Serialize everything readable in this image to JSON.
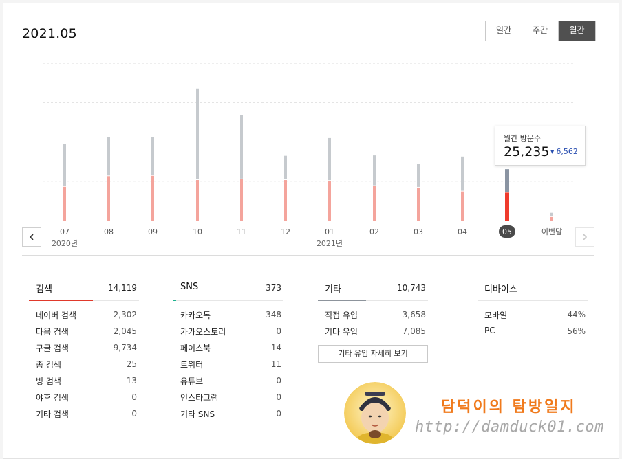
{
  "header": {
    "title": "2021.05"
  },
  "period_tabs": [
    {
      "label": "일간",
      "active": false
    },
    {
      "label": "주간",
      "active": false
    },
    {
      "label": "월간",
      "active": true
    }
  ],
  "colors": {
    "gray_bar": "#c6cace",
    "red_bar": "#f4a49c",
    "selected_red": "#ef3b2d",
    "selected_gray": "#8a94a2",
    "grid": "#dcdcdc"
  },
  "chart_data": {
    "type": "bar",
    "stacked": true,
    "categories": [
      "07",
      "08",
      "09",
      "10",
      "11",
      "12",
      "01",
      "02",
      "03",
      "04",
      "05",
      "이번달"
    ],
    "year_labels": [
      {
        "index": 0,
        "label": "2020년"
      },
      {
        "index": 6,
        "label": "2021년"
      }
    ],
    "series": [
      {
        "values": [
          8600,
          11300,
          11400,
          10300,
          10500,
          10300,
          10100,
          8800,
          8400,
          7400,
          7100,
          900
        ]
      },
      {
        "values": [
          10700,
          9700,
          9700,
          23100,
          16100,
          6000,
          10700,
          7600,
          5800,
          8700,
          5800,
          900
        ]
      }
    ],
    "ylim": [
      0,
      40000
    ],
    "grid": true,
    "selected_index": 10
  },
  "tooltip": {
    "label": "월간 방문수",
    "value": "25,235",
    "delta": "6,562",
    "delta_arrow": "▼"
  },
  "stats": [
    {
      "key": "search",
      "label": "검색",
      "total": "14,119",
      "accent": "#e0392b",
      "bar_fraction": 0.58,
      "rows": [
        {
          "label": "네이버 검색",
          "value": "2,302"
        },
        {
          "label": "다음 검색",
          "value": "2,045"
        },
        {
          "label": "구글 검색",
          "value": "9,734"
        },
        {
          "label": "좀 검색",
          "value": "25"
        },
        {
          "label": "빙 검색",
          "value": "13"
        },
        {
          "label": "야후 검색",
          "value": "0"
        },
        {
          "label": "기타 검색",
          "value": "0"
        }
      ]
    },
    {
      "key": "sns",
      "label": "SNS",
      "total": "373",
      "accent": "#1bb28e",
      "bar_fraction": 0.025,
      "rows": [
        {
          "label": "카카오톡",
          "value": "348"
        },
        {
          "label": "카카오스토리",
          "value": "0"
        },
        {
          "label": "페이스북",
          "value": "14"
        },
        {
          "label": "트위터",
          "value": "11"
        },
        {
          "label": "유튜브",
          "value": "0"
        },
        {
          "label": "인스타그램",
          "value": "0"
        },
        {
          "label": "기타 SNS",
          "value": "0"
        }
      ]
    },
    {
      "key": "etc",
      "label": "기타",
      "total": "10,743",
      "accent": "#8d949c",
      "bar_fraction": 0.44,
      "rows": [
        {
          "label": "직접 유입",
          "value": "3,658"
        },
        {
          "label": "기타 유입",
          "value": "7,085"
        }
      ],
      "button": "기타 유입 자세히 보기"
    },
    {
      "key": "device",
      "label": "디바이스",
      "total": "",
      "accent": "#e6e6e6",
      "bar_fraction": 0,
      "rows": [
        {
          "label": "모바일",
          "value": "44%"
        },
        {
          "label": "PC",
          "value": "56%"
        }
      ]
    }
  ],
  "brand": {
    "name": "담덕이의 탐방일지",
    "url": "http://damduck01.com"
  }
}
